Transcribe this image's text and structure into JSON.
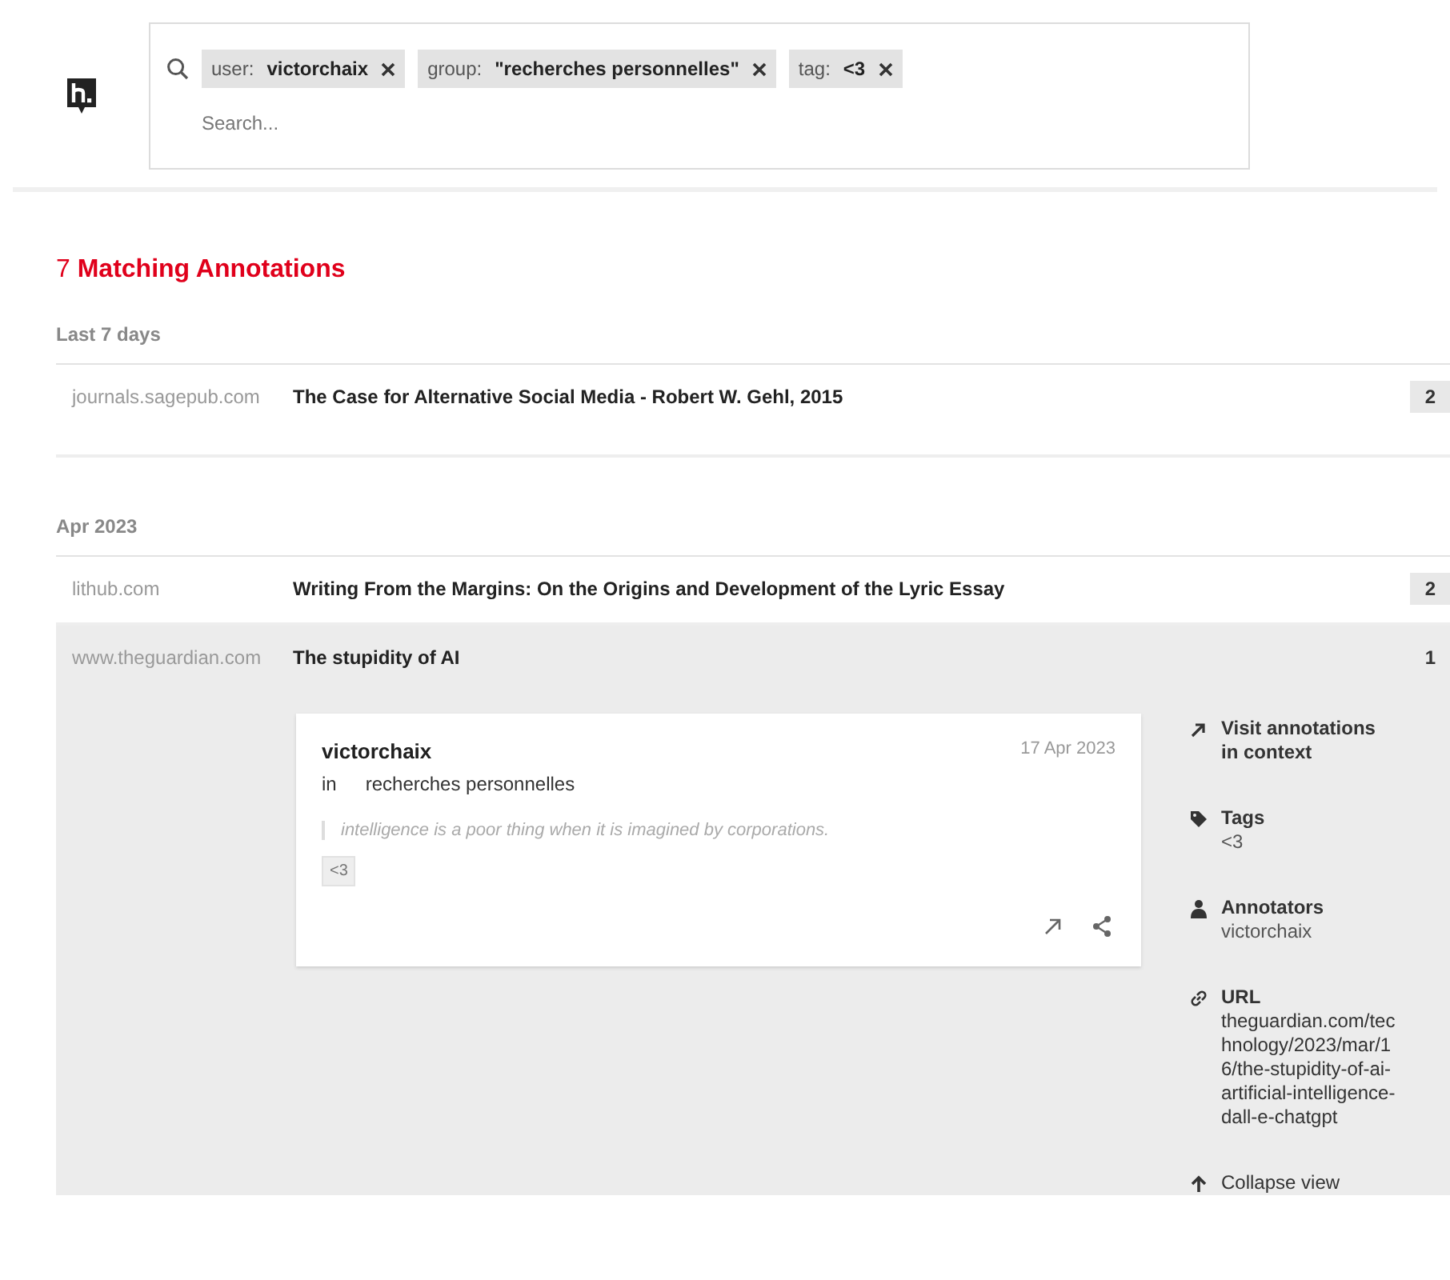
{
  "search": {
    "facets": [
      {
        "key": "user:",
        "value": "victorchaix"
      },
      {
        "key": "group:",
        "value": "\"recherches personnelles\""
      },
      {
        "key": "tag:",
        "value": "<3"
      }
    ],
    "placeholder": "Search..."
  },
  "heading": "7 **Matching Annotations**",
  "groups": [
    {
      "label": "Last 7 days",
      "rows": [
        {
          "domain": "journals.sagepub.com",
          "title": "The Case for Alternative Social Media - Robert W. Gehl, 2015",
          "count": "2",
          "expanded": false
        }
      ]
    },
    {
      "label": "Apr 2023",
      "rows": [
        {
          "domain": "lithub.com",
          "title": "Writing From the Margins: On the Origins and Development of the Lyric Essay",
          "count": "2",
          "expanded": false
        },
        {
          "domain": "www.theguardian.com",
          "title": "The stupidity of AI",
          "count": "1",
          "expanded": true,
          "annotation": {
            "user": "victorchaix",
            "group_prefix": "in",
            "group": "recherches personnelles",
            "date": "17 Apr 2023",
            "quote": "intelligence is a poor thing when it is imagined by corporations.",
            "tags": [
              "<3"
            ]
          },
          "sidebar": [
            {
              "kind": "visit",
              "label": "Visit annotations in context"
            },
            {
              "kind": "tags",
              "label": "Tags",
              "value": "<3"
            },
            {
              "kind": "annotators",
              "label": "Annotators",
              "value": "victorchaix"
            },
            {
              "kind": "url",
              "label": "URL",
              "value": "theguardian.com/technology/2023/mar/16/the-stupidity-of-ai-artificial-intelligence-dall-e-chatgpt"
            },
            {
              "kind": "collapse",
              "label": "Collapse view"
            }
          ]
        }
      ]
    }
  ]
}
